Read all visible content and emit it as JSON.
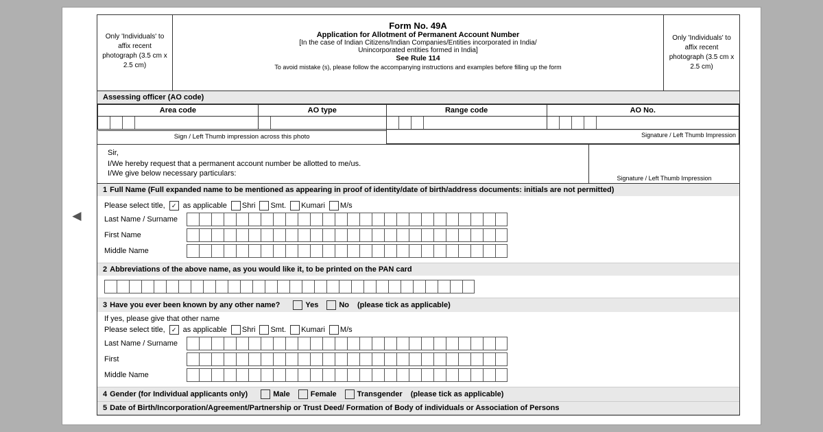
{
  "nav": {
    "back_arrow": "◄"
  },
  "form": {
    "title1": "Form No. 49A",
    "title2": "Application for Allotment of Permanent Account Number",
    "title3": "[In the case of Indian Citizens/Indian Companies/Entities incorporated in India/",
    "title4": "Unincorporated entities formed in India]",
    "rule": "See Rule 114",
    "avoid_note": "To avoid mistake (s), please follow the accompanying instructions and examples before filling up the form",
    "photo_left_text": "Only 'Individuals' to affix recent photograph (3.5 cm x 2.5 cm)",
    "photo_right_text": "Only 'Individuals' to affix recent photograph (3.5 cm x 2.5 cm)",
    "sign_label": "Sign / Left Thumb impression across this photo",
    "ao_section_header": "Assessing officer (AO code)",
    "ao_columns": {
      "area_code": "Area code",
      "ao_type": "AO type",
      "range_code": "Range code",
      "ao_no": "AO No."
    },
    "sir_text": "Sir,",
    "request_text1": "I/We hereby request that a permanent account number be allotted to me/us.",
    "request_text2": "I/We give below necessary particulars:",
    "signature_label": "Signature / Left Thumb Impression",
    "section1": {
      "num": "1",
      "label": "Full Name (Full expanded name to be mentioned as appearing in proof of identity/date of birth/address documents: initials are not permitted)",
      "title_label": "Please select title,",
      "as_applicable": "as applicable",
      "shri": "Shri",
      "smt": "Smt.",
      "kumari": "Kumari",
      "ms": "M/s",
      "last_name_label": "Last Name / Surname",
      "first_name_label": "First Name",
      "middle_name_label": "Middle Name"
    },
    "section2": {
      "num": "2",
      "label": "Abbreviations of the above name, as you would like it, to be printed on the PAN card"
    },
    "section3": {
      "num": "3",
      "label": "Have you ever been known by any other name?",
      "yes_label": "Yes",
      "no_label": "No",
      "note": "(please tick as applicable)",
      "if_yes": "If yes, please give that other name",
      "title_label": "Please select title,",
      "as_applicable": "as applicable",
      "shri": "Shri",
      "smt": "Smt.",
      "kumari": "Kumari",
      "ms": "M/s",
      "last_name_label": "Last Name / Surname",
      "first_name_label": "First",
      "middle_name_label": "Middle Name"
    },
    "section4": {
      "num": "4",
      "label": "Gender (for Individual applicants only)",
      "male": "Male",
      "female": "Female",
      "transgender": "Transgender",
      "note": "(please tick as applicable)"
    },
    "section5": {
      "num": "5",
      "label": "Date of Birth/Incorporation/Agreement/Partnership or Trust Deed/ Formation of Body of individuals or Association of Persons"
    }
  }
}
